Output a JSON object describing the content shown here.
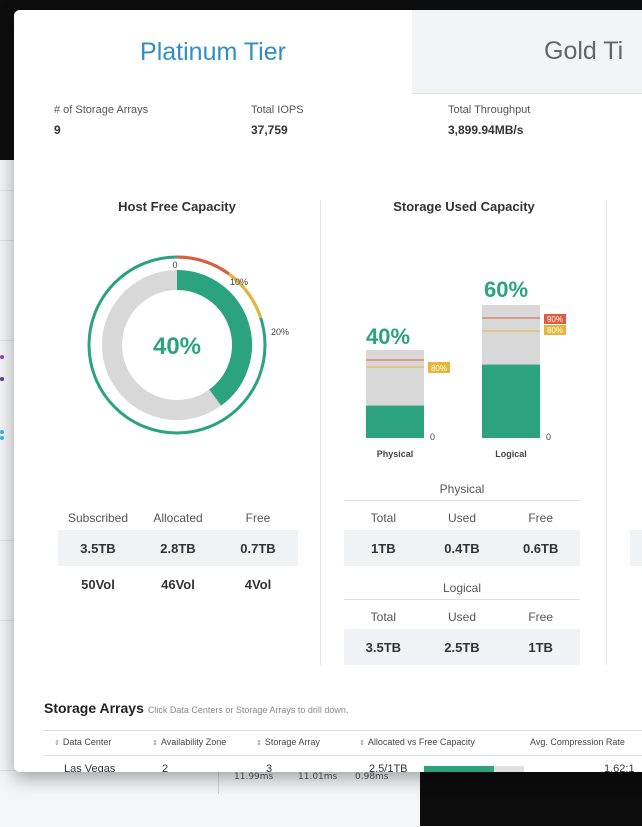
{
  "tabs": [
    "Platinum Tier",
    "Gold Ti"
  ],
  "stats": [
    {
      "label": "# of Storage Arrays",
      "value": "9"
    },
    {
      "label": "Total IOPS",
      "value": "37,759"
    },
    {
      "label": "Total Throughput",
      "value": "3,899.94MB/s"
    }
  ],
  "host_free_capacity": {
    "title": "Host Free Capacity",
    "center_label": "40%",
    "free_fraction": 0.4,
    "threshold_labels": [
      "0",
      "10%",
      "20%"
    ],
    "colors": {
      "fill": "#2ba37f",
      "track": "#d8d8d8",
      "warn_red": "#e15b3c",
      "warn_yellow": "#e9b43a"
    },
    "table": {
      "headers": [
        "Subscribed",
        "Allocated",
        "Free"
      ],
      "row1": [
        "3.5TB",
        "2.8TB",
        "0.7TB"
      ],
      "row2": [
        "50Vol",
        "46Vol",
        "4Vol"
      ]
    }
  },
  "storage_used_capacity": {
    "title": "Storage Used Capacity",
    "physical": {
      "label": "Physical",
      "percent_label": "40%",
      "fraction": 0.4,
      "threshold_label": "80%",
      "zero": "0"
    },
    "logical": {
      "label": "Logical",
      "percent_label": "60%",
      "fraction": 0.6,
      "threshold_labels": [
        "90%",
        "80%"
      ],
      "zero": "0"
    },
    "physical_table": {
      "title": "Physical",
      "headers": [
        "Total",
        "Used",
        "Free"
      ],
      "values": [
        "1TB",
        "0.4TB",
        "0.6TB"
      ]
    },
    "logical_table": {
      "title": "Logical",
      "headers": [
        "Total",
        "Used",
        "Free"
      ],
      "values": [
        "3.5TB",
        "2.5TB",
        "1TB"
      ]
    }
  },
  "storage_arrays": {
    "title": "Storage Arrays",
    "hint": "Click Data Centers or Storage Arrays to drill down.",
    "columns": [
      "Data Center",
      "Availability Zone",
      "Storage Array",
      "Allocated vs Free Capacity",
      "Avg. Compression Rate"
    ],
    "row": {
      "data_center": "Las Vegas",
      "availability_zone": "2",
      "storage_array": "3",
      "capacity": "2.5/1TB",
      "capacity_fraction": 0.7,
      "compression": "1.62:1"
    }
  },
  "background_row": [
    "11.99ms",
    "11.01ms",
    "0.98ms"
  ]
}
